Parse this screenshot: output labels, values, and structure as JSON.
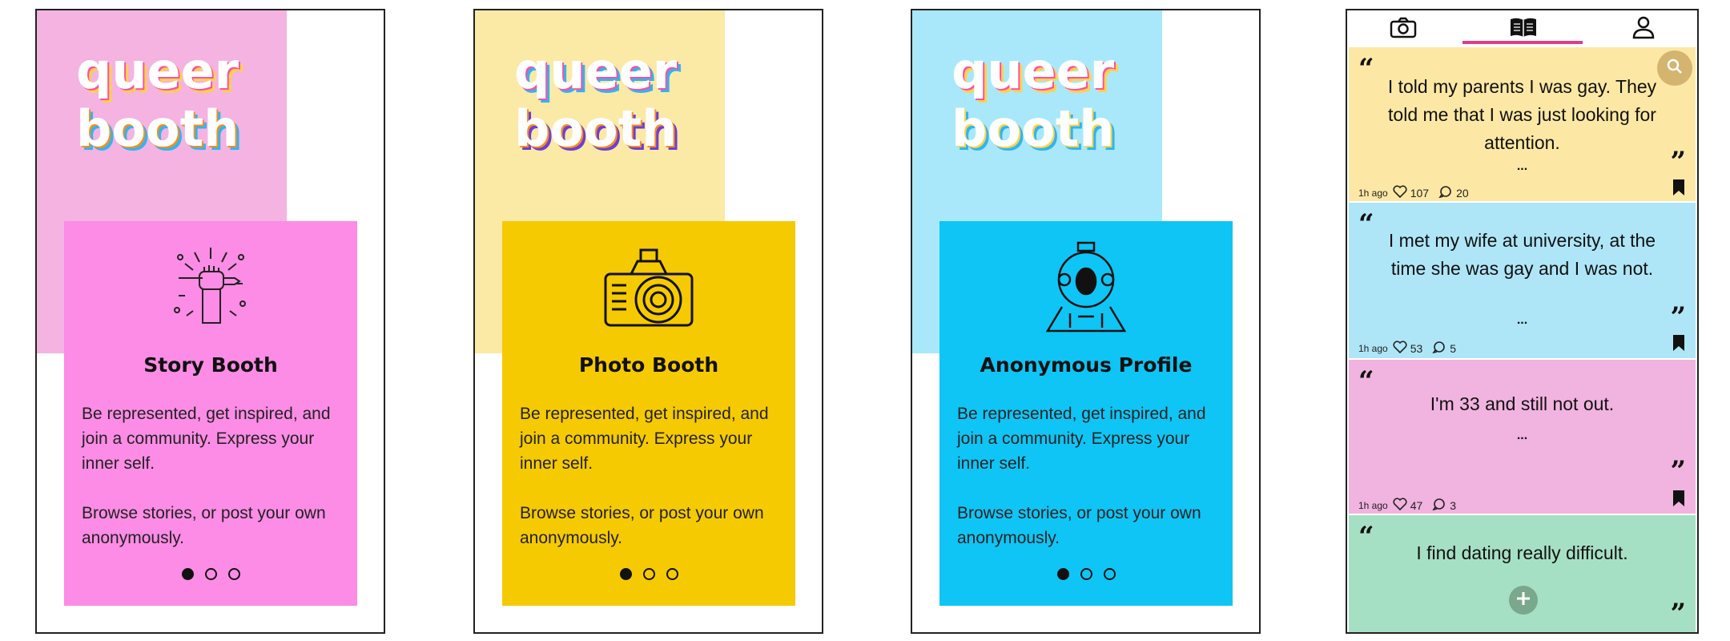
{
  "logo": {
    "line1": "queer",
    "line2": "booth"
  },
  "onboarding": [
    {
      "title": "Story Booth",
      "description_1": "Be represented, get inspired, and join a community. Express your inner self.",
      "description_2": "Browse stories, or post your own anonymously.",
      "icon": "fist-pencil-icon",
      "bg_color": "#f4b3e1",
      "card_color": "#fc8ce5"
    },
    {
      "title": "Photo Booth",
      "description_1": "Be represented, get inspired, and join a community. Express your inner self.",
      "description_2": "Browse stories, or post your own anonymously.",
      "icon": "camera-icon",
      "bg_color": "#fbe9a6",
      "card_color": "#f6ca00"
    },
    {
      "title": "Anonymous Profile",
      "description_1": "Be represented, get inspired, and join a community. Express your inner self.",
      "description_2": "Browse stories, or post your own anonymously.",
      "icon": "diving-helmet-icon",
      "bg_color": "#a8e8fa",
      "card_color": "#0ec5f5"
    }
  ],
  "feed": {
    "nav": [
      "camera-icon",
      "book-icon",
      "profile-icon"
    ],
    "active_tab": "book",
    "accent": "#e23c86",
    "stories": [
      {
        "text": "I told my parents I was gay. They told me that I was just looking for attention.",
        "ellipsis": "...",
        "time": "1h ago",
        "likes": "107",
        "comments": "20",
        "color": "#fce8a4"
      },
      {
        "text": "I met my wife at university, at the time she was gay and I was not.",
        "ellipsis": "...",
        "time": "1h ago",
        "likes": "53",
        "comments": "5",
        "color": "#aee6f7"
      },
      {
        "text": "I'm 33 and still not out.",
        "ellipsis": "...",
        "time": "1h ago",
        "likes": "47",
        "comments": "3",
        "color": "#f1b3df"
      },
      {
        "text": "I find dating really difficult.",
        "color": "#a6e0c4"
      }
    ]
  }
}
